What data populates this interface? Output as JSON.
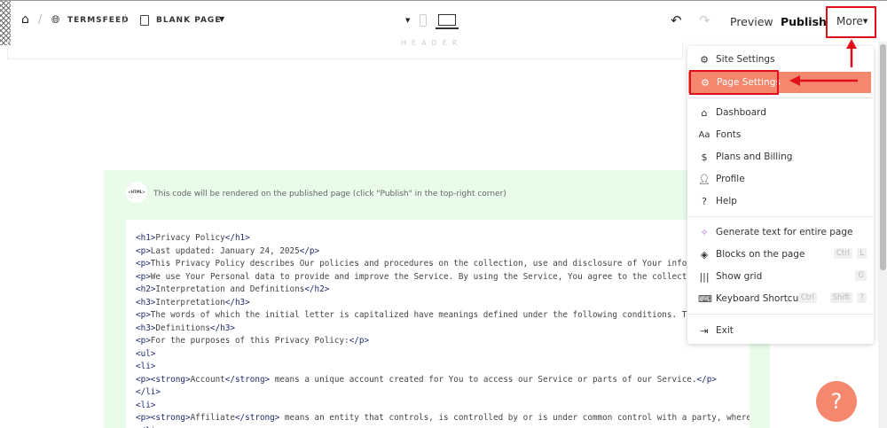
{
  "topbar": {
    "breadcrumb": [
      {
        "icon": "home-icon"
      },
      {
        "icon": "globe-icon",
        "label": "TERMSFEED"
      },
      {
        "icon": "page-icon",
        "label": "BLANK PAGE"
      }
    ],
    "device_icons": [
      "mobile-icon",
      "desktop-icon"
    ],
    "undo_icon": "undo-icon",
    "redo_icon": "redo-icon",
    "preview": "Preview",
    "publish": "Publish",
    "more": "More"
  },
  "canvas": {
    "header_label": "HEADER",
    "html_badge": "<HTML>",
    "note": "This code will be rendered on the published page (click \"Publish\" in the top-right corner)",
    "code_lines": [
      "<h1>Privacy Policy</h1>",
      "<p>Last updated: January 24, 2025</p>",
      "<p>This Privacy Policy describes Our policies and procedures on the collection, use and disclosure of Your information",
      "<p>We use Your Personal data to provide and improve the Service. By using the Service, You agree to the collection",
      "<h2>Interpretation and Definitions</h2>",
      "<h3>Interpretation</h3>",
      "<p>The words of which the initial letter is capitalized have meanings defined under the following conditions. The",
      "<h3>Definitions</h3>",
      "<p>For the purposes of this Privacy Policy:</p>",
      "<ul>",
      "<li>",
      "<p><strong>Account</strong> means a unique account created for You to access our Service or parts of our Service.</p>",
      "</li>",
      "<li>",
      "<p><strong>Affiliate</strong> means an entity that controls, is controlled by or is under common control with a party, where",
      "</li>"
    ]
  },
  "menu": {
    "items": [
      {
        "label": "Site Settings",
        "icon": "gear-icon"
      },
      {
        "label": "Page Settings",
        "icon": "gear-icon",
        "active": true
      },
      {
        "label": "Dashboard",
        "icon": "home-icon"
      },
      {
        "label": "Fonts",
        "icon": "fonts-icon",
        "glyph": "Aa"
      },
      {
        "label": "Plans and Billing",
        "icon": "dollar-icon"
      },
      {
        "label": "Profile",
        "icon": "user-icon"
      },
      {
        "label": "Help",
        "icon": "question-icon"
      },
      {
        "label": "Generate text for entire page",
        "icon": "sparkle-icon"
      },
      {
        "label": "Blocks on the page",
        "icon": "layers-icon",
        "shortcut": [
          "Ctrl",
          "L"
        ]
      },
      {
        "label": "Show grid",
        "icon": "grid-icon",
        "shortcut": [
          "G"
        ]
      },
      {
        "label": "Keyboard Shortcuts",
        "icon": "keyboard-icon",
        "shortcut": [
          "Ctrl",
          "Shift",
          "?"
        ]
      },
      {
        "label": "Exit",
        "icon": "exit-icon"
      }
    ]
  },
  "help_button": "?",
  "colors": {
    "accent": "#f4876e",
    "highlight_red": "#e0101a",
    "code_bg": "#e9fbe9",
    "tag": "#1f2a6e"
  }
}
